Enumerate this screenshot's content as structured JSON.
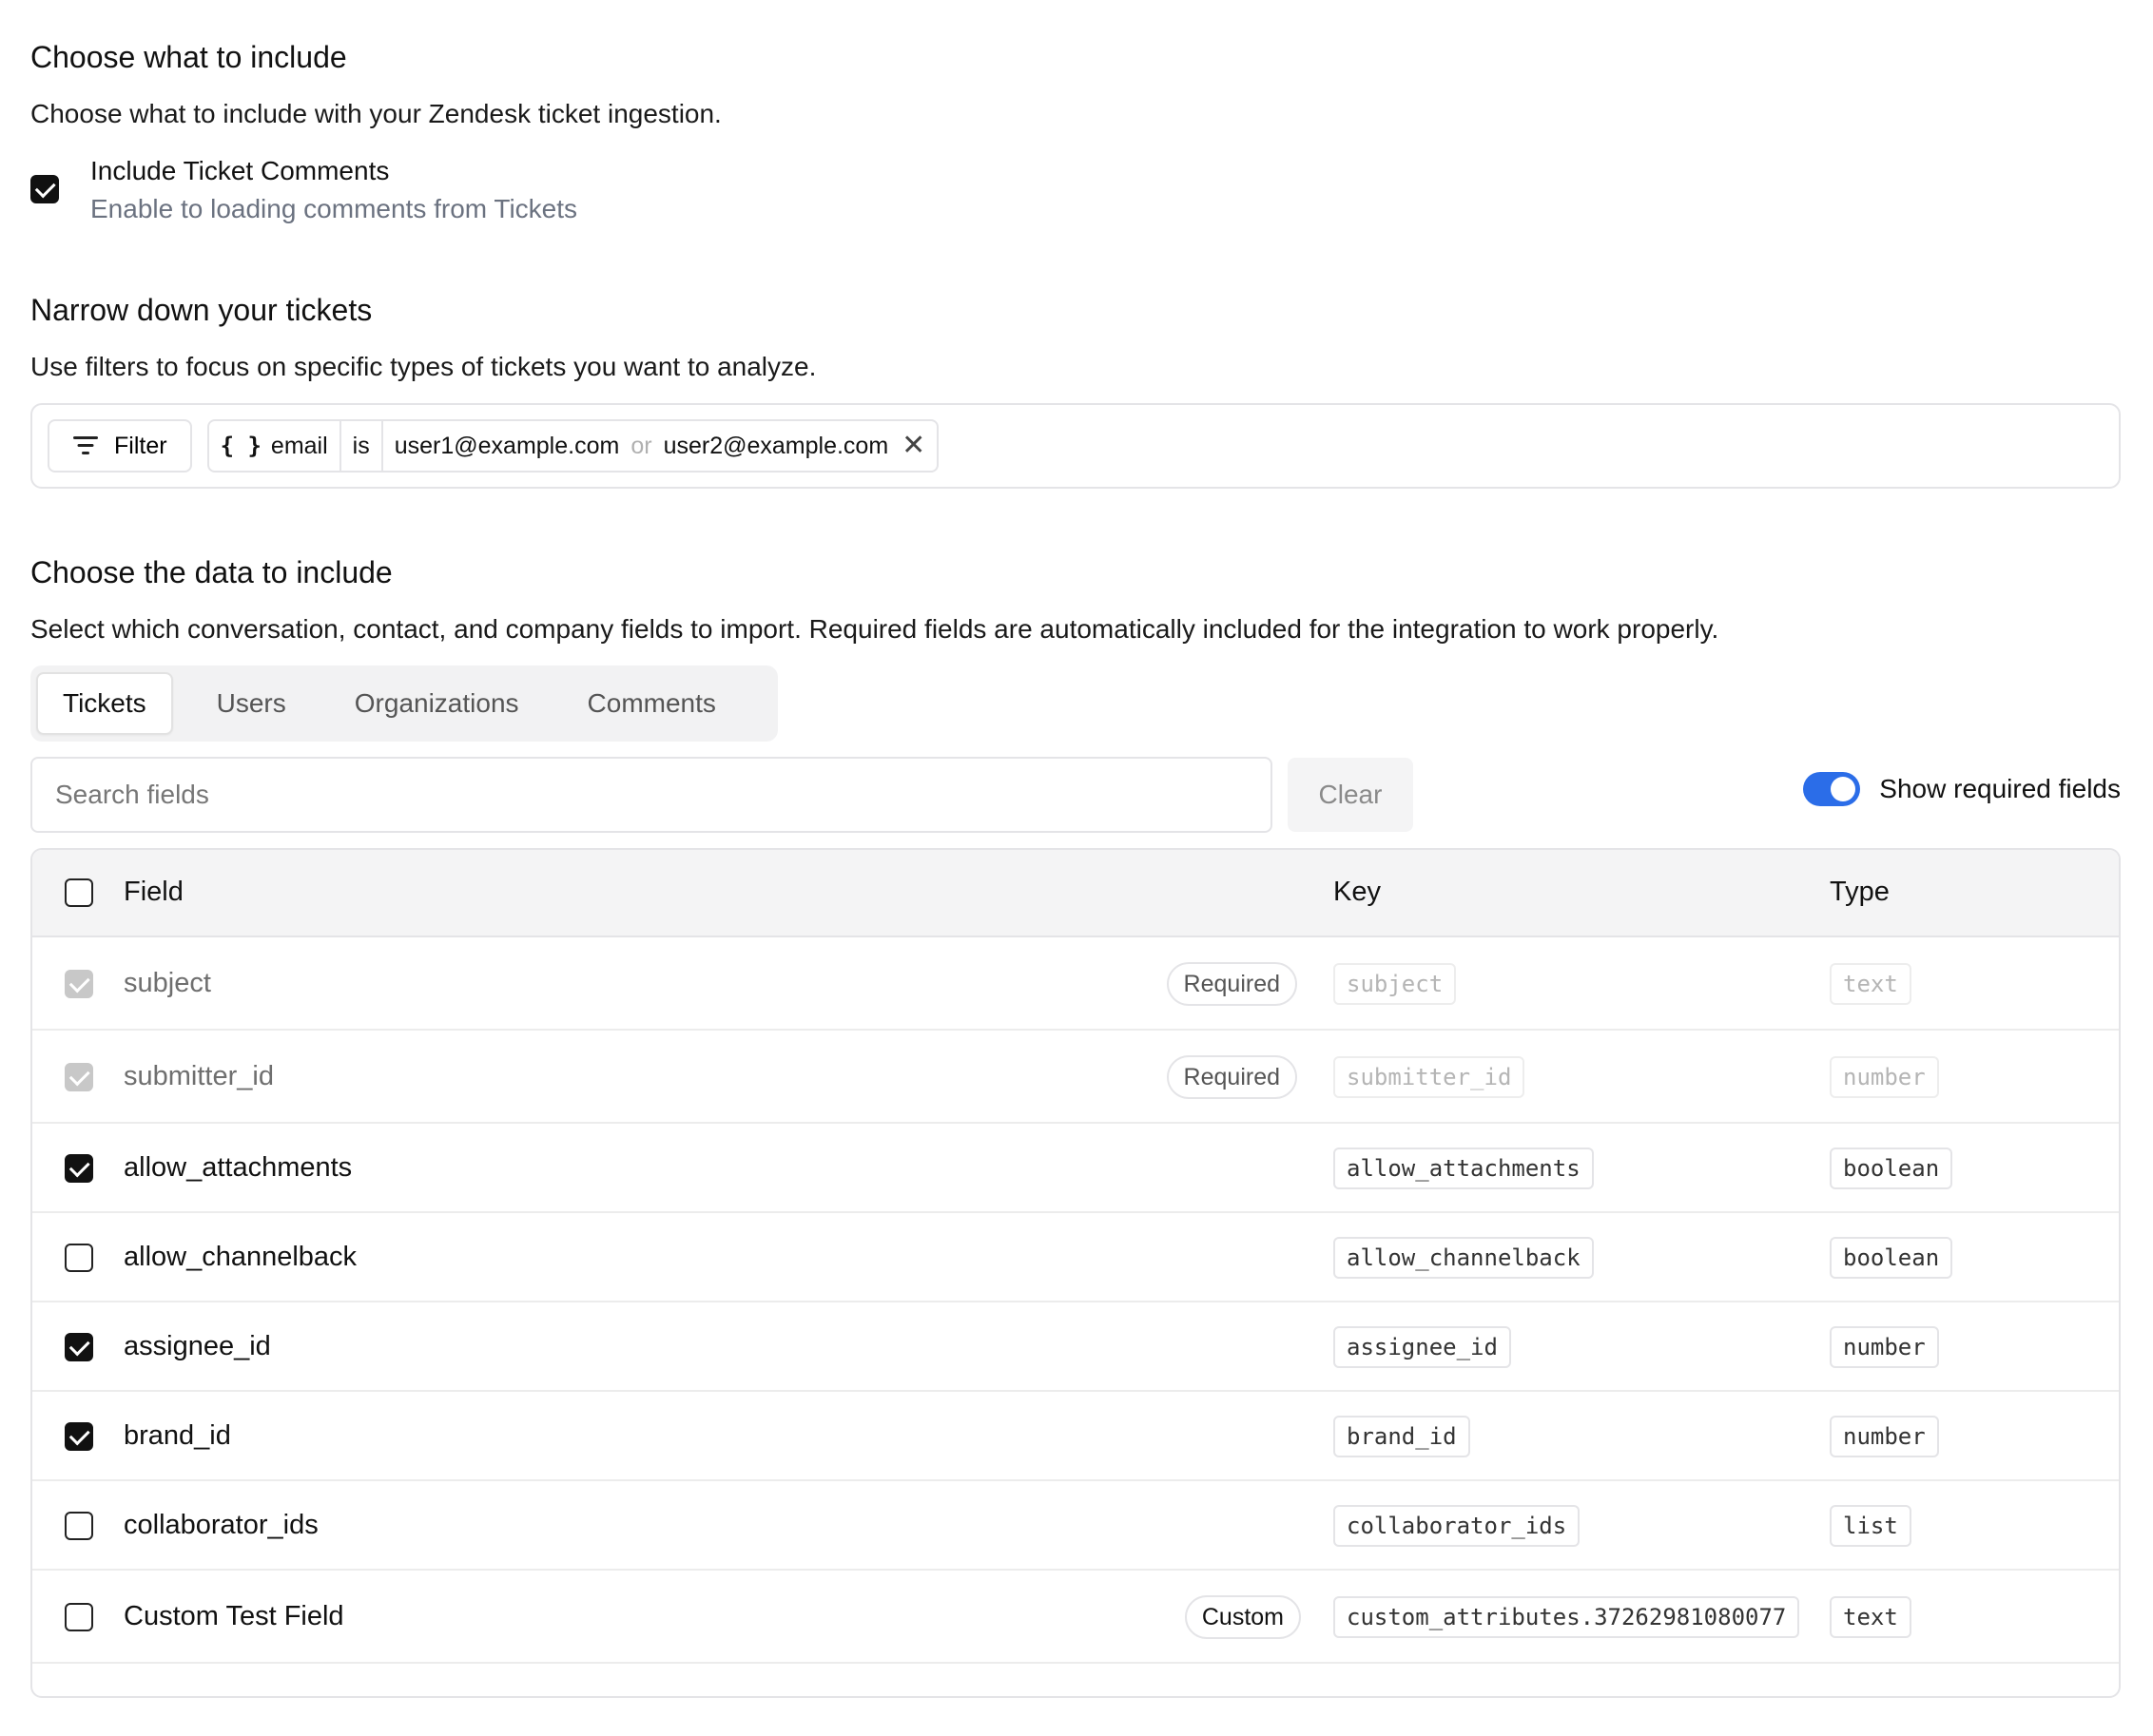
{
  "include_section": {
    "title": "Choose what to include",
    "description": "Choose what to include with your Zendesk ticket ingestion.",
    "option_label": "Include Ticket Comments",
    "option_sub": "Enable to loading comments from Tickets",
    "option_checked": true
  },
  "filter_section": {
    "title": "Narrow down your tickets",
    "description": "Use filters to focus on specific types of tickets you want to analyze.",
    "filter_button": "Filter",
    "chip": {
      "icon": "{ }",
      "field": "email",
      "operator": "is",
      "value1": "user1@example.com",
      "joiner": "or",
      "value2": "user2@example.com"
    }
  },
  "data_section": {
    "title": "Choose the data to include",
    "description": "Select which conversation, contact, and company fields to import. Required fields are automatically included for the integration to work properly.",
    "tabs": [
      "Tickets",
      "Users",
      "Organizations",
      "Comments"
    ],
    "active_tab": "Tickets",
    "search_placeholder": "Search fields",
    "clear_label": "Clear",
    "toggle_label": "Show required fields",
    "toggle_on": true,
    "toggle_color": "#2b6de8",
    "table": {
      "headers": {
        "field": "Field",
        "key": "Key",
        "type": "Type"
      },
      "rows": [
        {
          "field": "subject",
          "key": "subject",
          "type": "text",
          "badge": "Required",
          "state": "required"
        },
        {
          "field": "submitter_id",
          "key": "submitter_id",
          "type": "number",
          "badge": "Required",
          "state": "required"
        },
        {
          "field": "allow_attachments",
          "key": "allow_attachments",
          "type": "boolean",
          "badge": "",
          "state": "checked"
        },
        {
          "field": "allow_channelback",
          "key": "allow_channelback",
          "type": "boolean",
          "badge": "",
          "state": "unchecked"
        },
        {
          "field": "assignee_id",
          "key": "assignee_id",
          "type": "number",
          "badge": "",
          "state": "checked"
        },
        {
          "field": "brand_id",
          "key": "brand_id",
          "type": "number",
          "badge": "",
          "state": "checked"
        },
        {
          "field": "collaborator_ids",
          "key": "collaborator_ids",
          "type": "list",
          "badge": "",
          "state": "unchecked"
        },
        {
          "field": "Custom Test Field",
          "key": "custom_attributes.37262981080077",
          "type": "text",
          "badge": "Custom",
          "state": "unchecked"
        }
      ]
    }
  }
}
